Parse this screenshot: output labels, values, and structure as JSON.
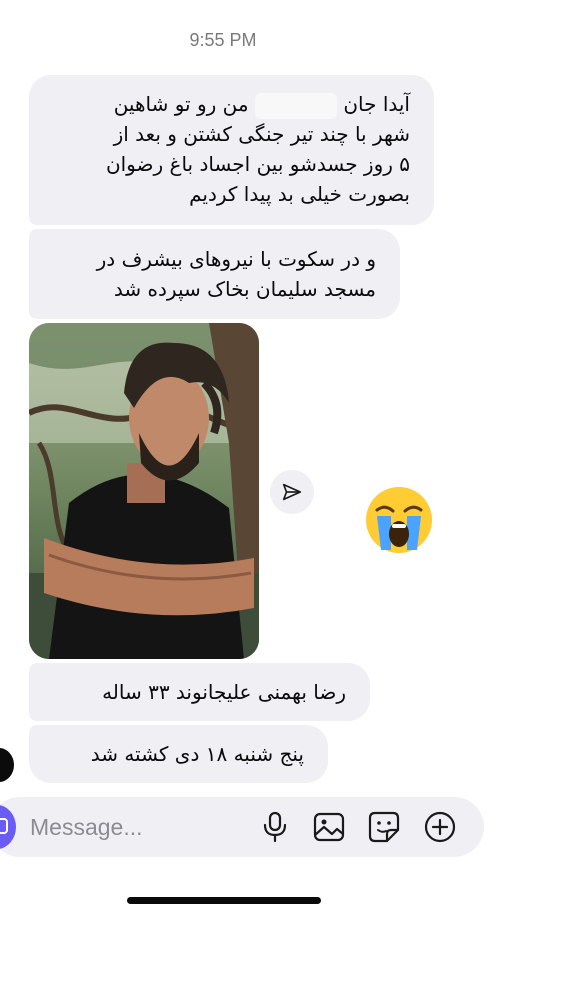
{
  "chat": {
    "timestamp": "9:55 PM",
    "messages": [
      {
        "lines": [
          "آیدا جان",
          "من رو تو شاهین",
          "شهر با چند تیر جنگی کشتن و بعد از",
          "۵ روز جسدشو بین اجساد باغ رضوان",
          "بصورت خیلی بد پیدا کردیم"
        ]
      },
      {
        "lines": [
          "و در سکوت با نیروهای بیشرف در",
          "مسجد سلیمان بخاک سپرده شد"
        ]
      },
      {
        "lines": [
          "رضا بهمنی علیجانوند ۳۳ ساله"
        ]
      },
      {
        "lines": [
          "پنج شنبه ۱۸ دی  کشته شد"
        ]
      }
    ],
    "shared_photo": {
      "type": "photo"
    },
    "reaction": {
      "emoji": "😭",
      "icon": "crying-face-emoji"
    }
  },
  "composer": {
    "placeholder": "Message...",
    "icons": [
      "microphone-icon",
      "image-icon",
      "sticker-icon",
      "plus-circle-icon"
    ]
  },
  "colors": {
    "bubble": "#efeff4",
    "accent": "#6b5cf5",
    "timestamp": "#7a7a7a"
  }
}
